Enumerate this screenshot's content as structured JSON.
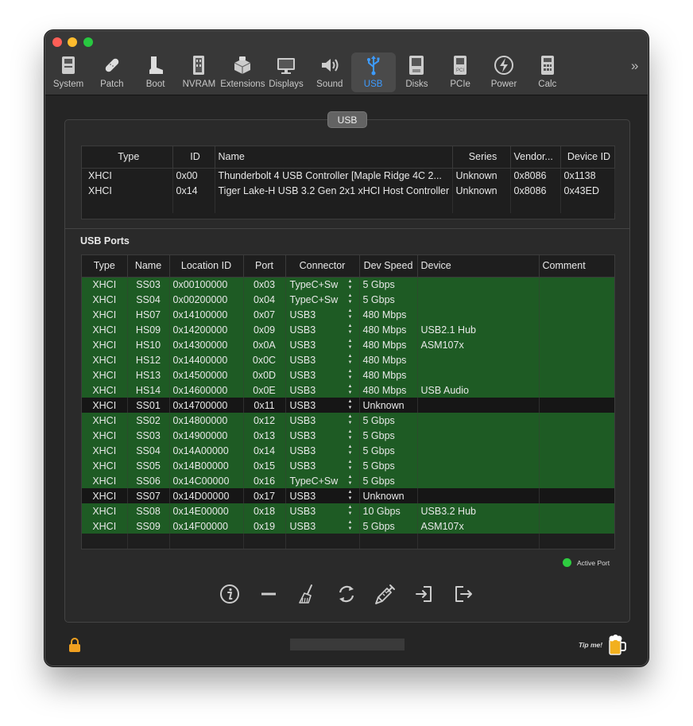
{
  "toolbar": {
    "items": [
      {
        "label": "System",
        "icon": "system-icon"
      },
      {
        "label": "Patch",
        "icon": "patch-icon"
      },
      {
        "label": "Boot",
        "icon": "boot-icon"
      },
      {
        "label": "NVRAM",
        "icon": "nvram-icon"
      },
      {
        "label": "Extensions",
        "icon": "extensions-icon"
      },
      {
        "label": "Displays",
        "icon": "displays-icon"
      },
      {
        "label": "Sound",
        "icon": "sound-icon"
      },
      {
        "label": "USB",
        "icon": "usb-icon"
      },
      {
        "label": "Disks",
        "icon": "disks-icon"
      },
      {
        "label": "PCIe",
        "icon": "pcie-icon"
      },
      {
        "label": "Power",
        "icon": "power-icon"
      },
      {
        "label": "Calc",
        "icon": "calc-icon"
      }
    ],
    "active": "USB",
    "more": "»"
  },
  "panel_tab": "USB",
  "controllers": {
    "columns": [
      "Type",
      "ID",
      "Name",
      "Series",
      "Vendor...",
      "Device ID"
    ],
    "rows": [
      [
        "XHCI",
        "0x00",
        "Thunderbolt 4 USB Controller [Maple Ridge 4C 2...",
        "Unknown",
        "0x8086",
        "0x1138"
      ],
      [
        "XHCI",
        "0x14",
        "Tiger Lake-H USB 3.2 Gen 2x1 xHCI Host Controller",
        "Unknown",
        "0x8086",
        "0x43ED"
      ]
    ]
  },
  "ports": {
    "title": "USB Ports",
    "columns": [
      "Type",
      "Name",
      "Location ID",
      "Port",
      "Connector",
      "Dev Speed",
      "Device",
      "Comment"
    ],
    "rows": [
      {
        "type": "XHCI",
        "name": "SS03",
        "location": "0x00100000",
        "port": "0x03",
        "connector": "TypeC+Sw",
        "speed": "5 Gbps",
        "device": "",
        "comment": "",
        "active": true
      },
      {
        "type": "XHCI",
        "name": "SS04",
        "location": "0x00200000",
        "port": "0x04",
        "connector": "TypeC+Sw",
        "speed": "5 Gbps",
        "device": "",
        "comment": "",
        "active": true
      },
      {
        "type": "XHCI",
        "name": "HS07",
        "location": "0x14100000",
        "port": "0x07",
        "connector": "USB3",
        "speed": "480 Mbps",
        "device": "",
        "comment": "",
        "active": true
      },
      {
        "type": "XHCI",
        "name": "HS09",
        "location": "0x14200000",
        "port": "0x09",
        "connector": "USB3",
        "speed": "480 Mbps",
        "device": "USB2.1 Hub",
        "comment": "",
        "active": true
      },
      {
        "type": "XHCI",
        "name": "HS10",
        "location": "0x14300000",
        "port": "0x0A",
        "connector": "USB3",
        "speed": "480 Mbps",
        "device": "ASM107x",
        "comment": "",
        "active": true
      },
      {
        "type": "XHCI",
        "name": "HS12",
        "location": "0x14400000",
        "port": "0x0C",
        "connector": "USB3",
        "speed": "480 Mbps",
        "device": "",
        "comment": "",
        "active": true
      },
      {
        "type": "XHCI",
        "name": "HS13",
        "location": "0x14500000",
        "port": "0x0D",
        "connector": "USB3",
        "speed": "480 Mbps",
        "device": "",
        "comment": "",
        "active": true
      },
      {
        "type": "XHCI",
        "name": "HS14",
        "location": "0x14600000",
        "port": "0x0E",
        "connector": "USB3",
        "speed": "480 Mbps",
        "device": "USB Audio",
        "comment": "",
        "active": true
      },
      {
        "type": "XHCI",
        "name": "SS01",
        "location": "0x14700000",
        "port": "0x11",
        "connector": "USB3",
        "speed": "Unknown",
        "device": "",
        "comment": "",
        "active": false
      },
      {
        "type": "XHCI",
        "name": "SS02",
        "location": "0x14800000",
        "port": "0x12",
        "connector": "USB3",
        "speed": "5 Gbps",
        "device": "",
        "comment": "",
        "active": true
      },
      {
        "type": "XHCI",
        "name": "SS03",
        "location": "0x14900000",
        "port": "0x13",
        "connector": "USB3",
        "speed": "5 Gbps",
        "device": "",
        "comment": "",
        "active": true
      },
      {
        "type": "XHCI",
        "name": "SS04",
        "location": "0x14A00000",
        "port": "0x14",
        "connector": "USB3",
        "speed": "5 Gbps",
        "device": "",
        "comment": "",
        "active": true
      },
      {
        "type": "XHCI",
        "name": "SS05",
        "location": "0x14B00000",
        "port": "0x15",
        "connector": "USB3",
        "speed": "5 Gbps",
        "device": "",
        "comment": "",
        "active": true
      },
      {
        "type": "XHCI",
        "name": "SS06",
        "location": "0x14C00000",
        "port": "0x16",
        "connector": "TypeC+Sw",
        "speed": "5 Gbps",
        "device": "",
        "comment": "",
        "active": true
      },
      {
        "type": "XHCI",
        "name": "SS07",
        "location": "0x14D00000",
        "port": "0x17",
        "connector": "USB3",
        "speed": "Unknown",
        "device": "",
        "comment": "",
        "active": false
      },
      {
        "type": "XHCI",
        "name": "SS08",
        "location": "0x14E00000",
        "port": "0x18",
        "connector": "USB3",
        "speed": "10 Gbps",
        "device": "USB3.2 Hub",
        "comment": "",
        "active": true
      },
      {
        "type": "XHCI",
        "name": "SS09",
        "location": "0x14F00000",
        "port": "0x19",
        "connector": "USB3",
        "speed": "5 Gbps",
        "device": "ASM107x",
        "comment": "",
        "active": true
      }
    ]
  },
  "legend": {
    "label": "Active Port",
    "color": "#2ecc40"
  },
  "actions": [
    "info-icon",
    "remove-icon",
    "broom-icon",
    "refresh-icon",
    "inject-icon",
    "import-icon",
    "export-icon"
  ],
  "footer": {
    "tip_label": "Tip me!"
  },
  "colors": {
    "active_row": "#1e5b24",
    "accent": "#3d9bff"
  }
}
